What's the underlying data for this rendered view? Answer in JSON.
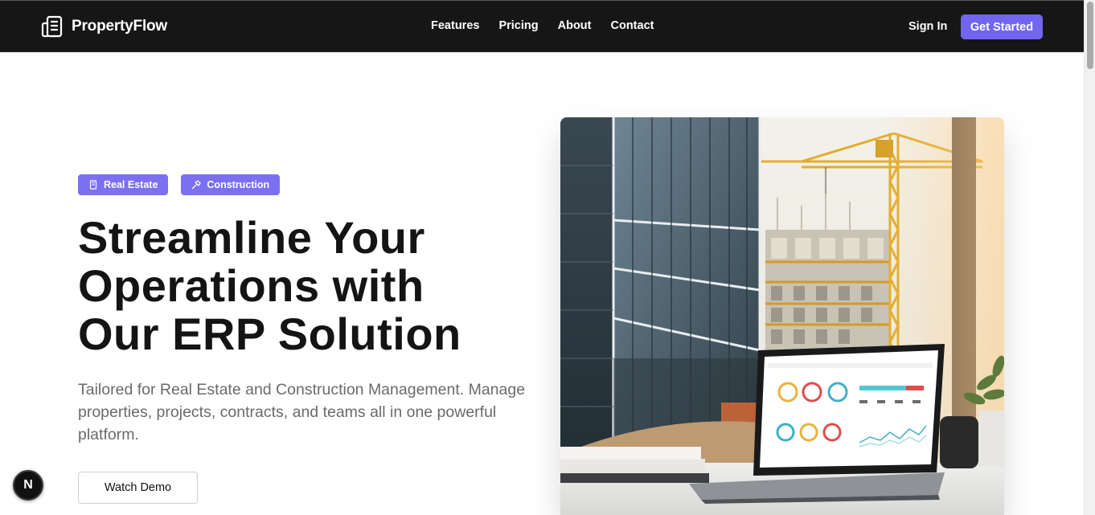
{
  "brand": {
    "name": "PropertyFlow",
    "icon": "building-icon"
  },
  "nav": {
    "links": [
      "Features",
      "Pricing",
      "About",
      "Contact"
    ],
    "sign_in": "Sign In",
    "get_started": "Get Started"
  },
  "hero": {
    "badges": [
      {
        "label": "Real Estate",
        "icon": "building-icon"
      },
      {
        "label": "Construction",
        "icon": "hammer-icon"
      }
    ],
    "headline": [
      "Streamline Your",
      "Operations with",
      "Our ERP Solution"
    ],
    "subtext": "Tailored for Real Estate and Construction Management. Manage properties, projects, contracts, and teams all in one powerful platform.",
    "watch_demo": "Watch Demo",
    "image_alt": "Office building, construction crane and laptop showing ERP dashboard"
  },
  "fab": {
    "label": "N"
  },
  "colors": {
    "accent": "#7166f0",
    "navbar": "#161616",
    "text": "#141414",
    "muted": "#6a6a6a"
  }
}
